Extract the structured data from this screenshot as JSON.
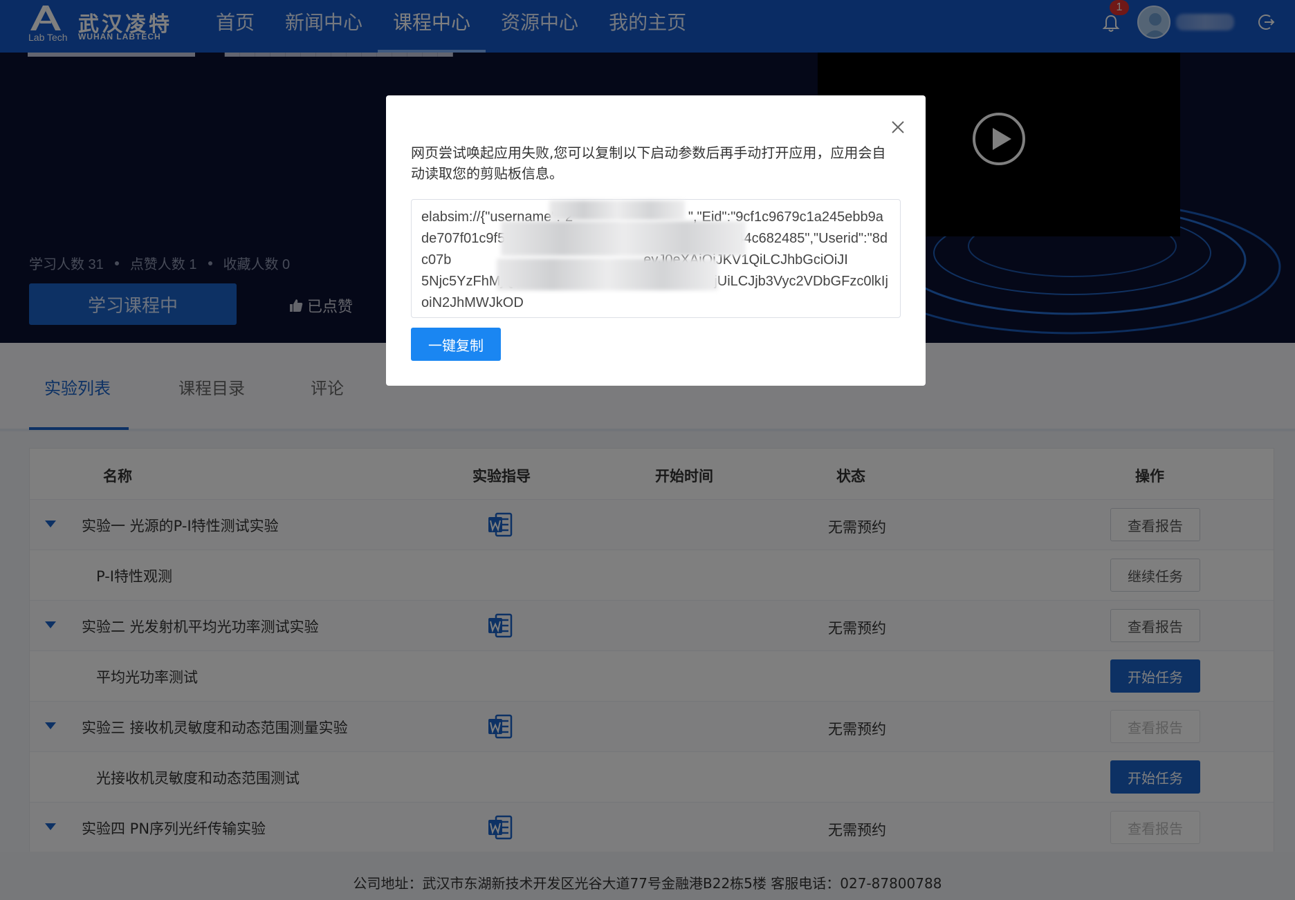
{
  "brand": {
    "name_cn": "武汉凌特",
    "name_en": "WUHAN LABTECH",
    "lab": "Lab Tech"
  },
  "nav": {
    "items": [
      {
        "label": "首页"
      },
      {
        "label": "新闻中心"
      },
      {
        "label": "课程中心",
        "active": true
      },
      {
        "label": "资源中心"
      },
      {
        "label": "我的主页"
      }
    ]
  },
  "header": {
    "notification_count": "1"
  },
  "hero": {
    "stats": {
      "learners": "学习人数 31",
      "likes": "点赞人数 1",
      "favorites": "收藏人数 0"
    },
    "learn_button": "学习课程中",
    "liked_label": "已点赞"
  },
  "tabs": [
    {
      "label": "实验列表"
    },
    {
      "label": "课程目录"
    },
    {
      "label": "评论"
    }
  ],
  "table": {
    "headers": {
      "name": "名称",
      "guide": "实验指导",
      "start": "开始时间",
      "status": "状态",
      "action": "操作"
    },
    "rows": [
      {
        "name": "实验一 光源的P-I特性测试实验",
        "status": "无需预约",
        "action": "查看报告"
      },
      {
        "name": "P-I特性观测",
        "action": "继续任务"
      },
      {
        "name": "实验二 光发射机平均光功率测试实验",
        "status": "无需预约",
        "action": "查看报告"
      },
      {
        "name": "平均光功率测试",
        "action": "开始任务"
      },
      {
        "name": "实验三 接收机灵敏度和动态范围测量实验",
        "status": "无需预约",
        "action": "查看报告"
      },
      {
        "name": "光接收机灵敏度和动态范围测试",
        "action": "开始任务"
      },
      {
        "name": "实验四 PN序列光纤传输实验",
        "status": "无需预约",
        "action": "查看报告"
      }
    ]
  },
  "footer": {
    "address": "公司地址：武汉市东湖新技术开发区光谷大道77号金融港B22栋5楼 客服电话：027-87800788"
  },
  "modal": {
    "message": "网页尝试唤起应用失败,您可以复制以下启动参数后再手动打开应用，应用会自动读取您的剪贴板信息。",
    "launch_params": "elabsim://{\"username\":\"2                              \",\"Eid\":\"9cf1c9679c1a245ebb9ade707f01c9f5\",\"Taskid\":\"cb6f   1a66e8f45b1de2e9044c682485\",\"Userid\":\"8dc07b                                                  eyJ0eXAiOiJKV1QiLCJhbGciOiJI                                          5Njc5YzFhMjQ1ZWJiOWFkZTcwN2YwMWM5ZjUiLCJjb3Vyc2VDbGFzc0lkIjoiN2JhMWJkOD",
    "copy_button": "一键复制"
  },
  "colors": {
    "header_bg": "#1458c9",
    "primary": "#1a63c9",
    "copy_button": "#1a86f2",
    "hero_bg": "#0a1030"
  }
}
